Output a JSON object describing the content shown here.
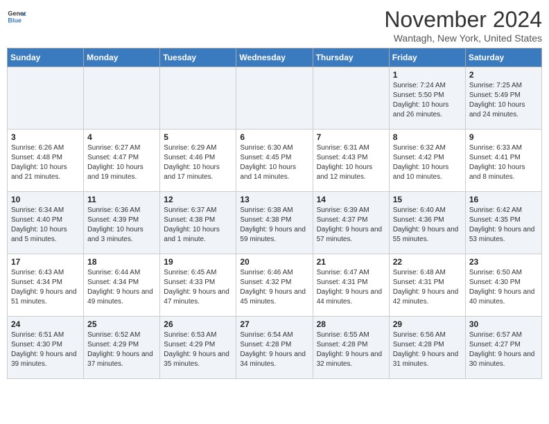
{
  "header": {
    "logo_line1": "General",
    "logo_line2": "Blue",
    "month": "November 2024",
    "location": "Wantagh, New York, United States"
  },
  "days_of_week": [
    "Sunday",
    "Monday",
    "Tuesday",
    "Wednesday",
    "Thursday",
    "Friday",
    "Saturday"
  ],
  "weeks": [
    [
      {
        "day": "",
        "info": ""
      },
      {
        "day": "",
        "info": ""
      },
      {
        "day": "",
        "info": ""
      },
      {
        "day": "",
        "info": ""
      },
      {
        "day": "",
        "info": ""
      },
      {
        "day": "1",
        "info": "Sunrise: 7:24 AM\nSunset: 5:50 PM\nDaylight: 10 hours and 26 minutes."
      },
      {
        "day": "2",
        "info": "Sunrise: 7:25 AM\nSunset: 5:49 PM\nDaylight: 10 hours and 24 minutes."
      }
    ],
    [
      {
        "day": "3",
        "info": "Sunrise: 6:26 AM\nSunset: 4:48 PM\nDaylight: 10 hours and 21 minutes."
      },
      {
        "day": "4",
        "info": "Sunrise: 6:27 AM\nSunset: 4:47 PM\nDaylight: 10 hours and 19 minutes."
      },
      {
        "day": "5",
        "info": "Sunrise: 6:29 AM\nSunset: 4:46 PM\nDaylight: 10 hours and 17 minutes."
      },
      {
        "day": "6",
        "info": "Sunrise: 6:30 AM\nSunset: 4:45 PM\nDaylight: 10 hours and 14 minutes."
      },
      {
        "day": "7",
        "info": "Sunrise: 6:31 AM\nSunset: 4:43 PM\nDaylight: 10 hours and 12 minutes."
      },
      {
        "day": "8",
        "info": "Sunrise: 6:32 AM\nSunset: 4:42 PM\nDaylight: 10 hours and 10 minutes."
      },
      {
        "day": "9",
        "info": "Sunrise: 6:33 AM\nSunset: 4:41 PM\nDaylight: 10 hours and 8 minutes."
      }
    ],
    [
      {
        "day": "10",
        "info": "Sunrise: 6:34 AM\nSunset: 4:40 PM\nDaylight: 10 hours and 5 minutes."
      },
      {
        "day": "11",
        "info": "Sunrise: 6:36 AM\nSunset: 4:39 PM\nDaylight: 10 hours and 3 minutes."
      },
      {
        "day": "12",
        "info": "Sunrise: 6:37 AM\nSunset: 4:38 PM\nDaylight: 10 hours and 1 minute."
      },
      {
        "day": "13",
        "info": "Sunrise: 6:38 AM\nSunset: 4:38 PM\nDaylight: 9 hours and 59 minutes."
      },
      {
        "day": "14",
        "info": "Sunrise: 6:39 AM\nSunset: 4:37 PM\nDaylight: 9 hours and 57 minutes."
      },
      {
        "day": "15",
        "info": "Sunrise: 6:40 AM\nSunset: 4:36 PM\nDaylight: 9 hours and 55 minutes."
      },
      {
        "day": "16",
        "info": "Sunrise: 6:42 AM\nSunset: 4:35 PM\nDaylight: 9 hours and 53 minutes."
      }
    ],
    [
      {
        "day": "17",
        "info": "Sunrise: 6:43 AM\nSunset: 4:34 PM\nDaylight: 9 hours and 51 minutes."
      },
      {
        "day": "18",
        "info": "Sunrise: 6:44 AM\nSunset: 4:34 PM\nDaylight: 9 hours and 49 minutes."
      },
      {
        "day": "19",
        "info": "Sunrise: 6:45 AM\nSunset: 4:33 PM\nDaylight: 9 hours and 47 minutes."
      },
      {
        "day": "20",
        "info": "Sunrise: 6:46 AM\nSunset: 4:32 PM\nDaylight: 9 hours and 45 minutes."
      },
      {
        "day": "21",
        "info": "Sunrise: 6:47 AM\nSunset: 4:31 PM\nDaylight: 9 hours and 44 minutes."
      },
      {
        "day": "22",
        "info": "Sunrise: 6:48 AM\nSunset: 4:31 PM\nDaylight: 9 hours and 42 minutes."
      },
      {
        "day": "23",
        "info": "Sunrise: 6:50 AM\nSunset: 4:30 PM\nDaylight: 9 hours and 40 minutes."
      }
    ],
    [
      {
        "day": "24",
        "info": "Sunrise: 6:51 AM\nSunset: 4:30 PM\nDaylight: 9 hours and 39 minutes."
      },
      {
        "day": "25",
        "info": "Sunrise: 6:52 AM\nSunset: 4:29 PM\nDaylight: 9 hours and 37 minutes."
      },
      {
        "day": "26",
        "info": "Sunrise: 6:53 AM\nSunset: 4:29 PM\nDaylight: 9 hours and 35 minutes."
      },
      {
        "day": "27",
        "info": "Sunrise: 6:54 AM\nSunset: 4:28 PM\nDaylight: 9 hours and 34 minutes."
      },
      {
        "day": "28",
        "info": "Sunrise: 6:55 AM\nSunset: 4:28 PM\nDaylight: 9 hours and 32 minutes."
      },
      {
        "day": "29",
        "info": "Sunrise: 6:56 AM\nSunset: 4:28 PM\nDaylight: 9 hours and 31 minutes."
      },
      {
        "day": "30",
        "info": "Sunrise: 6:57 AM\nSunset: 4:27 PM\nDaylight: 9 hours and 30 minutes."
      }
    ]
  ]
}
